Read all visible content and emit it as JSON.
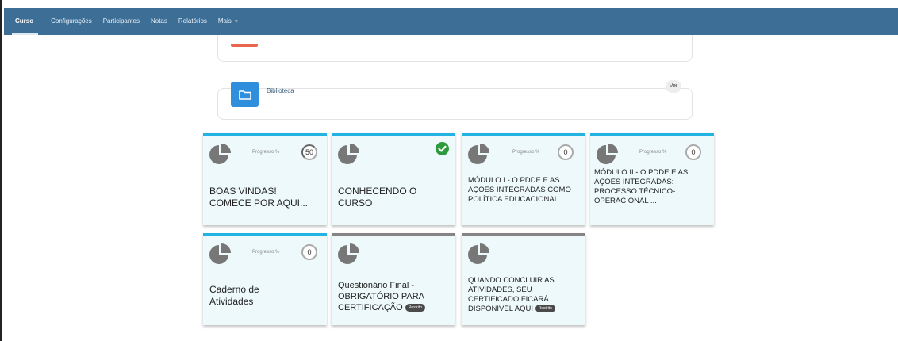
{
  "nav": {
    "items": [
      {
        "label": "Curso",
        "active": true
      },
      {
        "label": "Configurações"
      },
      {
        "label": "Participantes"
      },
      {
        "label": "Notas"
      },
      {
        "label": "Relatórios"
      },
      {
        "label": "Mais"
      }
    ],
    "more_caret": "▾"
  },
  "resource": {
    "label": "Biblioteca",
    "action_label": "Ver",
    "icon": "folder-icon",
    "icon_color": "#2f8fdd"
  },
  "colors": {
    "nav_bg": "#3c6e96",
    "tile_bg": "#edf9fb",
    "tile_accent": "#23b3e2",
    "tile_accent_restricted": "#858585",
    "complete_green": "#2e9a3d",
    "red_bar": "#e8654e"
  },
  "tiles": [
    {
      "title": "BOAS VINDAS! COMECE POR AQUI...",
      "progress_label": "Progresso %",
      "progress": "50"
    },
    {
      "title": "CONHECENDO O CURSO",
      "status": "complete-check-icon"
    },
    {
      "title": "MÓDULO I - O PDDE E AS AÇÕES INTEGRADAS COMO POLÍTICA EDUCACIONAL",
      "progress_label": "Progresso %",
      "progress": "0"
    },
    {
      "title": "MÓDULO II - O PDDE E AS AÇÕES INTEGRADAS: PROCESSO TÉCNICO-OPERACIONAL ...",
      "progress_label": "Progresso %",
      "progress": "0"
    },
    {
      "title": "Caderno de Atividades",
      "progress_label": "Progresso %",
      "progress": "0"
    },
    {
      "title": "Questionário Final - OBRIGATÓRIO PARA CERTIFICAÇÃO",
      "badge": "Restrito"
    },
    {
      "title": "QUANDO CONCLUIR AS ATIVIDADES, SEU CERTIFICADO FICARÁ DISPONÍVEL AQUI",
      "badge": "Restrito"
    }
  ]
}
